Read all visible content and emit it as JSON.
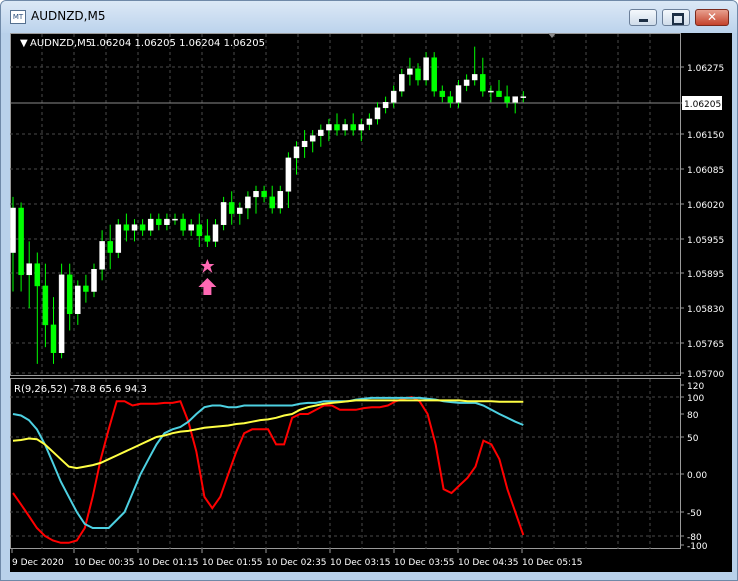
{
  "window": {
    "title": "AUDNZD,M5",
    "app_icon_text": "MT",
    "close_glyph": "✕"
  },
  "header": {
    "symbol": "AUDNZD,M5",
    "ohlc": "1.06204 1.06205 1.06204 1.06205",
    "indicator": "R(9,26,52) -78.8 65.6 94.3"
  },
  "colors": {
    "background": "#000000",
    "grid": "#4a4a4a",
    "bull_candle": "#ffffff",
    "bear_candle": "#00ff00",
    "wick": "#00ff00",
    "text": "#ffffff",
    "red_line": "#ff0000",
    "cyan_line": "#4dd0e1",
    "yellow_line": "#ffff44",
    "star": "#ff69b4",
    "arrow": "#ff69b4"
  },
  "price_axis": {
    "labels": [
      "1.06275",
      "1.06205",
      "1.06150",
      "1.06085",
      "1.06020",
      "1.05955",
      "1.05895",
      "1.05830",
      "1.05765",
      "1.05700"
    ],
    "current": "1.06205"
  },
  "indicator_axis": {
    "labels": [
      "120",
      "100",
      "80",
      "50",
      "0.00",
      "-50",
      "-80",
      "-100"
    ]
  },
  "time_axis": {
    "labels": [
      "9 Dec 2020",
      "10 Dec 00:35",
      "10 Dec 01:15",
      "10 Dec 01:55",
      "10 Dec 02:35",
      "10 Dec 03:15",
      "10 Dec 03:55",
      "10 Dec 04:35",
      "10 Dec 05:15"
    ]
  },
  "chart_data": [
    {
      "type": "candlestick",
      "symbol": "AUDNZD",
      "timeframe": "M5",
      "ylim": [
        1.057,
        1.063
      ],
      "current_price": 1.06205,
      "candles": [
        [
          1.0592,
          1.0602,
          1.0585,
          1.06
        ],
        [
          1.06,
          1.0601,
          1.0585,
          1.0588
        ],
        [
          1.0588,
          1.0594,
          1.0582,
          1.059
        ],
        [
          1.059,
          1.0592,
          1.0572,
          1.0586
        ],
        [
          1.0586,
          1.059,
          1.0575,
          1.0579
        ],
        [
          1.0579,
          1.0584,
          1.0572,
          1.0574
        ],
        [
          1.0574,
          1.059,
          1.0573,
          1.0588
        ],
        [
          1.0588,
          1.059,
          1.0578,
          1.0581
        ],
        [
          1.0581,
          1.0587,
          1.0579,
          1.0586
        ],
        [
          1.0586,
          1.0588,
          1.0583,
          1.0585
        ],
        [
          1.0585,
          1.059,
          1.0584,
          1.0589
        ],
        [
          1.0589,
          1.0596,
          1.0587,
          1.0594
        ],
        [
          1.0594,
          1.0597,
          1.0589,
          1.0592
        ],
        [
          1.0592,
          1.0598,
          1.0591,
          1.0597
        ],
        [
          1.0597,
          1.0599,
          1.0594,
          1.0596
        ],
        [
          1.0596,
          1.0598,
          1.0594,
          1.0597
        ],
        [
          1.0597,
          1.0598,
          1.0595,
          1.0596
        ],
        [
          1.0596,
          1.0599,
          1.0595,
          1.0598
        ],
        [
          1.0598,
          1.0599,
          1.0596,
          1.0597
        ],
        [
          1.0597,
          1.0599,
          1.0596,
          1.0598
        ],
        [
          1.0598,
          1.0599,
          1.0597,
          1.0598
        ],
        [
          1.0598,
          1.0599,
          1.0595,
          1.0596
        ],
        [
          1.0596,
          1.0598,
          1.0595,
          1.0597
        ],
        [
          1.0597,
          1.0599,
          1.0593,
          1.0595
        ],
        [
          1.0595,
          1.0598,
          1.0593,
          1.0594
        ],
        [
          1.0594,
          1.0598,
          1.0593,
          1.0597
        ],
        [
          1.0597,
          1.0602,
          1.0596,
          1.0601
        ],
        [
          1.0601,
          1.0603,
          1.0597,
          1.0599
        ],
        [
          1.0599,
          1.0601,
          1.0597,
          1.06
        ],
        [
          1.06,
          1.0603,
          1.0598,
          1.0602
        ],
        [
          1.0602,
          1.0604,
          1.0599,
          1.0603
        ],
        [
          1.0603,
          1.0604,
          1.0601,
          1.0602
        ],
        [
          1.0602,
          1.0604,
          1.0599,
          1.06
        ],
        [
          1.06,
          1.0604,
          1.0599,
          1.0603
        ],
        [
          1.0603,
          1.061,
          1.06,
          1.0609
        ],
        [
          1.0609,
          1.0612,
          1.0606,
          1.0611
        ],
        [
          1.0611,
          1.0614,
          1.0609,
          1.0612
        ],
        [
          1.0612,
          1.0614,
          1.061,
          1.0613
        ],
        [
          1.0613,
          1.0615,
          1.0611,
          1.0614
        ],
        [
          1.0614,
          1.0616,
          1.0612,
          1.0615
        ],
        [
          1.0615,
          1.0617,
          1.0613,
          1.0614
        ],
        [
          1.0614,
          1.0616,
          1.0613,
          1.0615
        ],
        [
          1.0615,
          1.0617,
          1.0613,
          1.0614
        ],
        [
          1.0614,
          1.0616,
          1.0612,
          1.0615
        ],
        [
          1.0615,
          1.0617,
          1.0614,
          1.0616
        ],
        [
          1.0616,
          1.0619,
          1.0615,
          1.0618
        ],
        [
          1.0618,
          1.062,
          1.0617,
          1.0619
        ],
        [
          1.0619,
          1.0622,
          1.0618,
          1.0621
        ],
        [
          1.0621,
          1.0625,
          1.062,
          1.0624
        ],
        [
          1.0624,
          1.0627,
          1.0622,
          1.0625
        ],
        [
          1.0625,
          1.0626,
          1.0622,
          1.0623
        ],
        [
          1.0623,
          1.0628,
          1.0622,
          1.0627
        ],
        [
          1.0627,
          1.0628,
          1.062,
          1.0621
        ],
        [
          1.0621,
          1.0622,
          1.0619,
          1.062
        ],
        [
          1.062,
          1.0621,
          1.0618,
          1.0619
        ],
        [
          1.0619,
          1.0623,
          1.0618,
          1.0622
        ],
        [
          1.0622,
          1.0624,
          1.0621,
          1.0623
        ],
        [
          1.0623,
          1.0629,
          1.0622,
          1.0624
        ],
        [
          1.0624,
          1.0627,
          1.062,
          1.0621
        ],
        [
          1.0621,
          1.0622,
          1.0619,
          1.0621
        ],
        [
          1.0621,
          1.0623,
          1.062,
          1.062
        ],
        [
          1.062,
          1.0622,
          1.0618,
          1.0619
        ],
        [
          1.0619,
          1.062,
          1.0617,
          1.062
        ],
        [
          1.062,
          1.0621,
          1.0619,
          1.062
        ]
      ]
    },
    {
      "type": "line",
      "name": "R(9,26,52)",
      "ylim": [
        -100,
        120
      ],
      "series": [
        {
          "color": "red",
          "values": [
            -25,
            -40,
            -55,
            -70,
            -80,
            -90,
            -95,
            -95,
            -90,
            -70,
            -30,
            20,
            60,
            95,
            95,
            90,
            92,
            92,
            92,
            93,
            93,
            95,
            70,
            30,
            -30,
            -45,
            -30,
            0,
            30,
            55,
            60,
            60,
            60,
            40,
            40,
            75,
            80,
            80,
            85,
            90,
            90,
            85,
            85,
            85,
            87,
            88,
            88,
            90,
            95,
            98,
            100,
            95,
            80,
            40,
            -20,
            -25,
            -15,
            -5,
            10,
            45,
            40,
            20,
            -20,
            -50,
            -78.8
          ]
        },
        {
          "color": "cyan",
          "values": [
            80,
            78,
            72,
            60,
            40,
            15,
            -10,
            -30,
            -50,
            -65,
            -70,
            -70,
            -70,
            -60,
            -50,
            -25,
            0,
            20,
            40,
            55,
            60,
            63,
            70,
            80,
            88,
            90,
            90,
            88,
            88,
            90,
            90,
            90,
            90,
            90,
            90,
            90,
            92,
            93,
            93,
            95,
            95,
            95,
            95,
            97,
            98,
            99,
            99,
            99,
            99,
            99,
            99,
            99,
            98,
            97,
            95,
            94,
            93,
            93,
            93,
            90,
            85,
            80,
            75,
            70,
            65.6
          ]
        },
        {
          "color": "yellow",
          "values": [
            45,
            46,
            48,
            47,
            40,
            30,
            20,
            10,
            8,
            10,
            12,
            15,
            20,
            25,
            30,
            35,
            40,
            45,
            50,
            52,
            55,
            57,
            58,
            60,
            62,
            63,
            64,
            65,
            67,
            68,
            70,
            72,
            73,
            75,
            78,
            80,
            85,
            88,
            90,
            92,
            93,
            94,
            95,
            96,
            96,
            96,
            96,
            96,
            96,
            96,
            96,
            96,
            96,
            96,
            96,
            96,
            96,
            95,
            95,
            95,
            95,
            94.5,
            94.3,
            94.3,
            94.3
          ]
        }
      ]
    }
  ]
}
